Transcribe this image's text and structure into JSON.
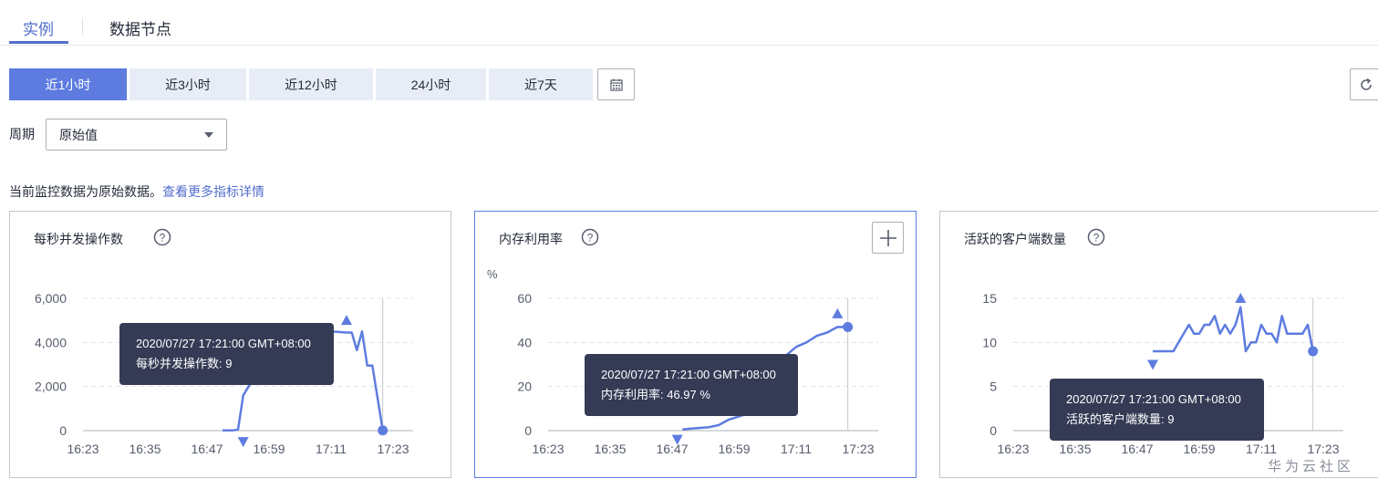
{
  "tabs": [
    {
      "label": "实例",
      "active": true
    },
    {
      "label": "数据节点",
      "active": false
    }
  ],
  "time_ranges": [
    {
      "label": "近1小时",
      "active": true
    },
    {
      "label": "近3小时",
      "active": false
    },
    {
      "label": "近12小时",
      "active": false
    },
    {
      "label": "24小时",
      "active": false
    },
    {
      "label": "近7天",
      "active": false
    }
  ],
  "icons": {
    "calendar": "calendar-icon",
    "refresh": "refresh-icon",
    "help": "help-circle-icon",
    "add": "plus-icon"
  },
  "period": {
    "label": "周期",
    "value": "原始值"
  },
  "notice": {
    "text": "当前监控数据为原始数据。",
    "link": "查看更多指标详情"
  },
  "colors": {
    "accent": "#5e7ce0",
    "tooltip_bg": "#353b55"
  },
  "charts": [
    {
      "title": "每秒并发操作数",
      "unit": "",
      "tooltip": {
        "time": "2020/07/27 17:21:00 GMT+08:00",
        "line": "每秒并发操作数: 9"
      },
      "chart_data": {
        "type": "line",
        "xlabel": "",
        "ylabel": "",
        "x_ticks": [
          "16:23",
          "16:35",
          "16:47",
          "16:59",
          "17:11",
          "17:23"
        ],
        "y_ticks": [
          "0",
          "2,000",
          "4,000",
          "6,000"
        ],
        "ylim": [
          0,
          6000
        ],
        "x": [
          "16:50",
          "16:51",
          "16:52",
          "16:53",
          "16:54",
          "17:01",
          "17:06",
          "17:11",
          "17:14",
          "17:15",
          "17:16",
          "17:17",
          "17:18",
          "17:19",
          "17:21"
        ],
        "series": [
          {
            "values": [
              10,
              10,
              10,
              50,
              1600,
              4300,
              4450,
              4500,
              4450,
              4450,
              3650,
              4500,
              2950,
              2950,
              9
            ]
          }
        ],
        "max_marker": {
          "x": "17:14",
          "value": 5000
        },
        "min_marker": {
          "x": "16:54",
          "value": -500
        },
        "current_point": {
          "x": "17:21",
          "value": 9
        }
      }
    },
    {
      "title": "内存利用率",
      "unit": "%",
      "tooltip": {
        "time": "2020/07/27 17:21:00 GMT+08:00",
        "line": "内存利用率: 46.97 %"
      },
      "chart_data": {
        "type": "line",
        "xlabel": "",
        "ylabel": "%",
        "x_ticks": [
          "16:23",
          "16:35",
          "16:47",
          "16:59",
          "17:11",
          "17:23"
        ],
        "y_ticks": [
          "0",
          "20",
          "40",
          "60"
        ],
        "ylim": [
          0,
          60
        ],
        "x": [
          "16:49",
          "16:51",
          "16:54",
          "16:56",
          "16:58",
          "17:00",
          "17:02",
          "17:05",
          "17:07",
          "17:09",
          "17:11",
          "17:13",
          "17:15",
          "17:17",
          "17:19",
          "17:21"
        ],
        "series": [
          {
            "values": [
              0.5,
              1,
              1.5,
              2.5,
              5,
              6.5,
              8,
              10,
              24,
              34,
              38,
              40,
              43,
              44.5,
              47,
              46.97
            ]
          }
        ],
        "max_marker": {
          "x": "17:19",
          "value": 53
        },
        "min_marker": {
          "x": "16:48",
          "value": -4
        },
        "current_point": {
          "x": "17:21",
          "value": 46.97
        }
      }
    },
    {
      "title": "活跃的客户端数量",
      "unit": "",
      "tooltip": {
        "time": "2020/07/27 17:21:00 GMT+08:00",
        "line": "活跃的客户端数量: 9"
      },
      "chart_data": {
        "type": "line",
        "xlabel": "",
        "ylabel": "",
        "x_ticks": [
          "16:23",
          "16:35",
          "16:47",
          "16:59",
          "17:11",
          "17:23"
        ],
        "y_ticks": [
          "0",
          "5",
          "10",
          "15"
        ],
        "ylim": [
          0,
          15
        ],
        "x": [
          "16:50",
          "16:51",
          "16:53",
          "16:54",
          "16:55",
          "16:57",
          "16:58",
          "16:59",
          "17:00",
          "17:01",
          "17:02",
          "17:03",
          "17:04",
          "17:05",
          "17:06",
          "17:07",
          "17:08",
          "17:09",
          "17:10",
          "17:11",
          "17:12",
          "17:13",
          "17:14",
          "17:15",
          "17:16",
          "17:17",
          "17:18",
          "17:19",
          "17:20",
          "17:21"
        ],
        "series": [
          {
            "values": [
              9,
              9,
              9,
              9,
              10,
              12,
              11,
              11,
              12,
              12,
              13,
              11,
              12,
              11,
              12,
              14,
              9,
              10,
              10,
              12,
              11,
              11,
              10,
              13,
              11,
              11,
              11,
              11,
              12,
              9
            ]
          }
        ],
        "max_marker": {
          "x": "17:07",
          "value": 15
        },
        "min_marker": {
          "x": "16:50",
          "value": 7.5
        },
        "current_point": {
          "x": "17:21",
          "value": 9
        }
      }
    }
  ],
  "watermark": "华为云社区"
}
